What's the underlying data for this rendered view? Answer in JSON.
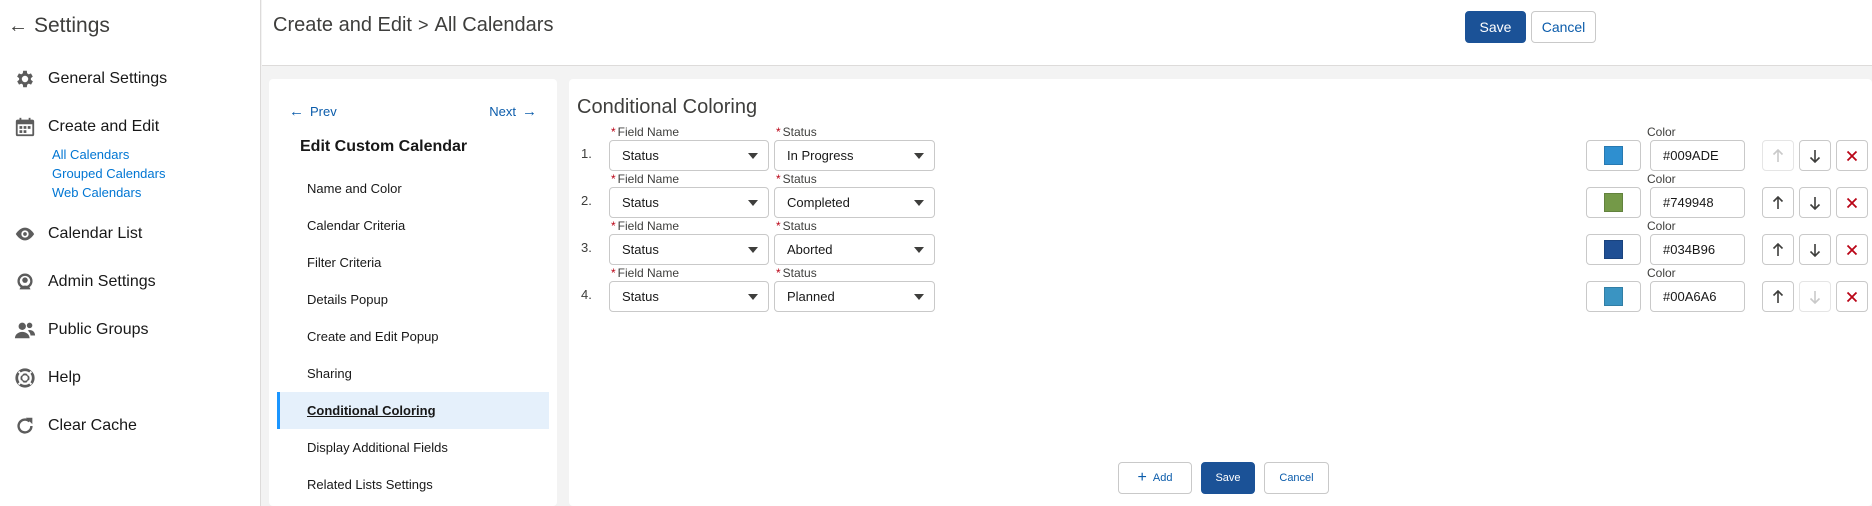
{
  "sidebar": {
    "title": "Settings",
    "items": [
      {
        "label": "General Settings",
        "icon": "gear-icon"
      },
      {
        "label": "Create and Edit",
        "icon": "calendar-icon"
      },
      {
        "label": "Calendar List",
        "icon": "eye-icon"
      },
      {
        "label": "Admin Settings",
        "icon": "admin-user-icon"
      },
      {
        "label": "Public Groups",
        "icon": "users-icon"
      },
      {
        "label": "Help",
        "icon": "help-lifebuoy-icon"
      },
      {
        "label": "Clear Cache",
        "icon": "refresh-icon"
      }
    ],
    "sub_links": [
      "All Calendars",
      "Grouped Calendars",
      "Web Calendars"
    ]
  },
  "header": {
    "breadcrumb_parent": "Create and Edit",
    "breadcrumb_current": "All Calendars",
    "save_label": "Save",
    "cancel_label": "Cancel"
  },
  "nav": {
    "prev_label": "Prev",
    "next_label": "Next",
    "title": "Edit Custom Calendar",
    "items": [
      "Name and Color",
      "Calendar Criteria",
      "Filter Criteria",
      "Details Popup",
      "Create and Edit Popup",
      "Sharing",
      "Conditional Coloring",
      "Display Additional Fields",
      "Related Lists Settings"
    ],
    "active_index": 6
  },
  "content": {
    "title": "Conditional Coloring",
    "field_name_label": "Field Name",
    "status_label": "Status",
    "color_label": "Color",
    "rows": [
      {
        "num": "1.",
        "field": "Status",
        "status": "In Progress",
        "color": "#009ADE",
        "swatch": "#2e8fd0",
        "up_disabled": true,
        "down_disabled": false
      },
      {
        "num": "2.",
        "field": "Status",
        "status": "Completed",
        "color": "#749948",
        "swatch": "#749948",
        "up_disabled": false,
        "down_disabled": false
      },
      {
        "num": "3.",
        "field": "Status",
        "status": "Aborted",
        "color": "#034B96",
        "swatch": "#1f4f94",
        "up_disabled": false,
        "down_disabled": false
      },
      {
        "num": "4.",
        "field": "Status",
        "status": "Planned",
        "color": "#00A6A6",
        "swatch": "#3a94c2",
        "up_disabled": false,
        "down_disabled": true
      }
    ],
    "add_label": "Add",
    "save_label": "Save",
    "cancel_label": "Cancel"
  },
  "colors": {
    "brand": "#1b5297",
    "link": "#0b5cab",
    "delete": "#ba0517",
    "active_nav_bg": "#e5f0fb"
  }
}
